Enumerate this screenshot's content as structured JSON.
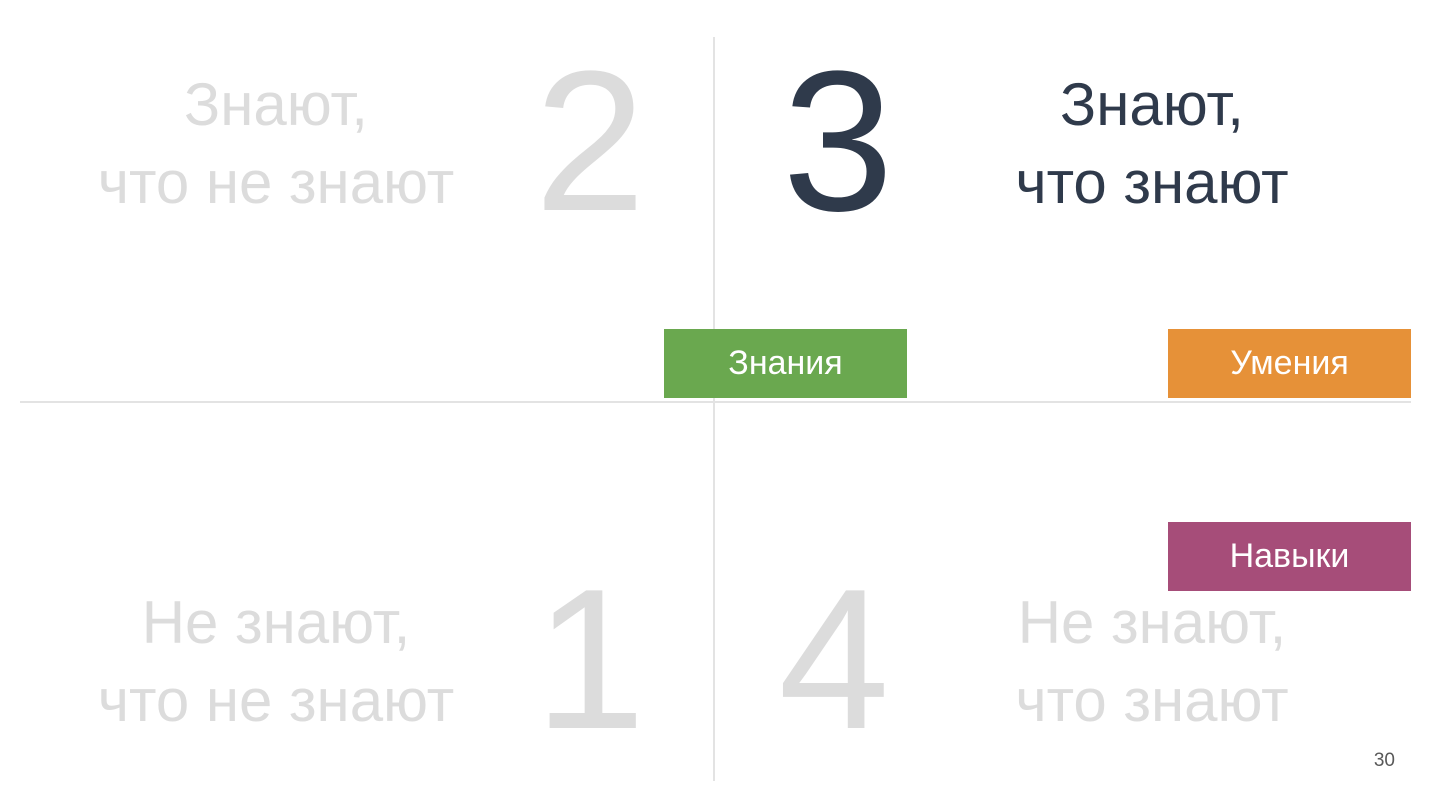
{
  "quadrants": {
    "q2": {
      "line1": "Знают,",
      "line2": "что не знают",
      "number": "2"
    },
    "q3": {
      "line1": "Знают,",
      "line2": "что знают",
      "number": "3"
    },
    "q1": {
      "line1": "Не знают,",
      "line2": "что не знают",
      "number": "1"
    },
    "q4": {
      "line1": "Не знают,",
      "line2": "что знают",
      "number": "4"
    }
  },
  "tags": {
    "knowledge": "Знания",
    "skills": "Умения",
    "habits": "Навыки"
  },
  "colors": {
    "knowledge": "#6aa84f",
    "skills": "#e69138",
    "habits": "#a64d79",
    "active_text": "#2f3a4b",
    "muted_text": "#dcdcdc"
  },
  "page_number": "30"
}
